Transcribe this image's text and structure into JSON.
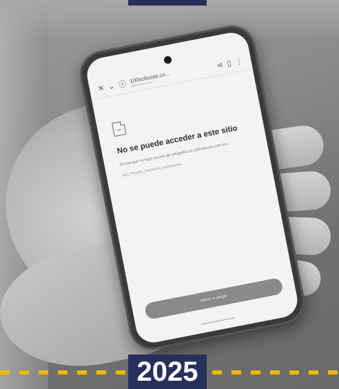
{
  "browser": {
    "close_icon": "close-icon",
    "chevron_icon": "chevron-down-icon",
    "info_icon": "info-icon",
    "url": "100xclisose.co...",
    "url_sub": "100xclisose.co.mx",
    "share_icon": "share-icon",
    "bookmark_icon": "bookmark-icon",
    "menu_icon": "more-vertical-icon"
  },
  "error_page": {
    "icon": "sad-document-icon",
    "title": "No se puede acceder a este sitio",
    "description": "Revisa que no haya errores de ortografía en 100xclisose.com.mx.",
    "code": "DNS_PROBE_FINISHED_NXDOMAIN",
    "reload_label": "Volver a cargar"
  },
  "banner": {
    "year": "2025",
    "colors": {
      "badge": "#26305a",
      "dash": "#f2b705"
    }
  }
}
